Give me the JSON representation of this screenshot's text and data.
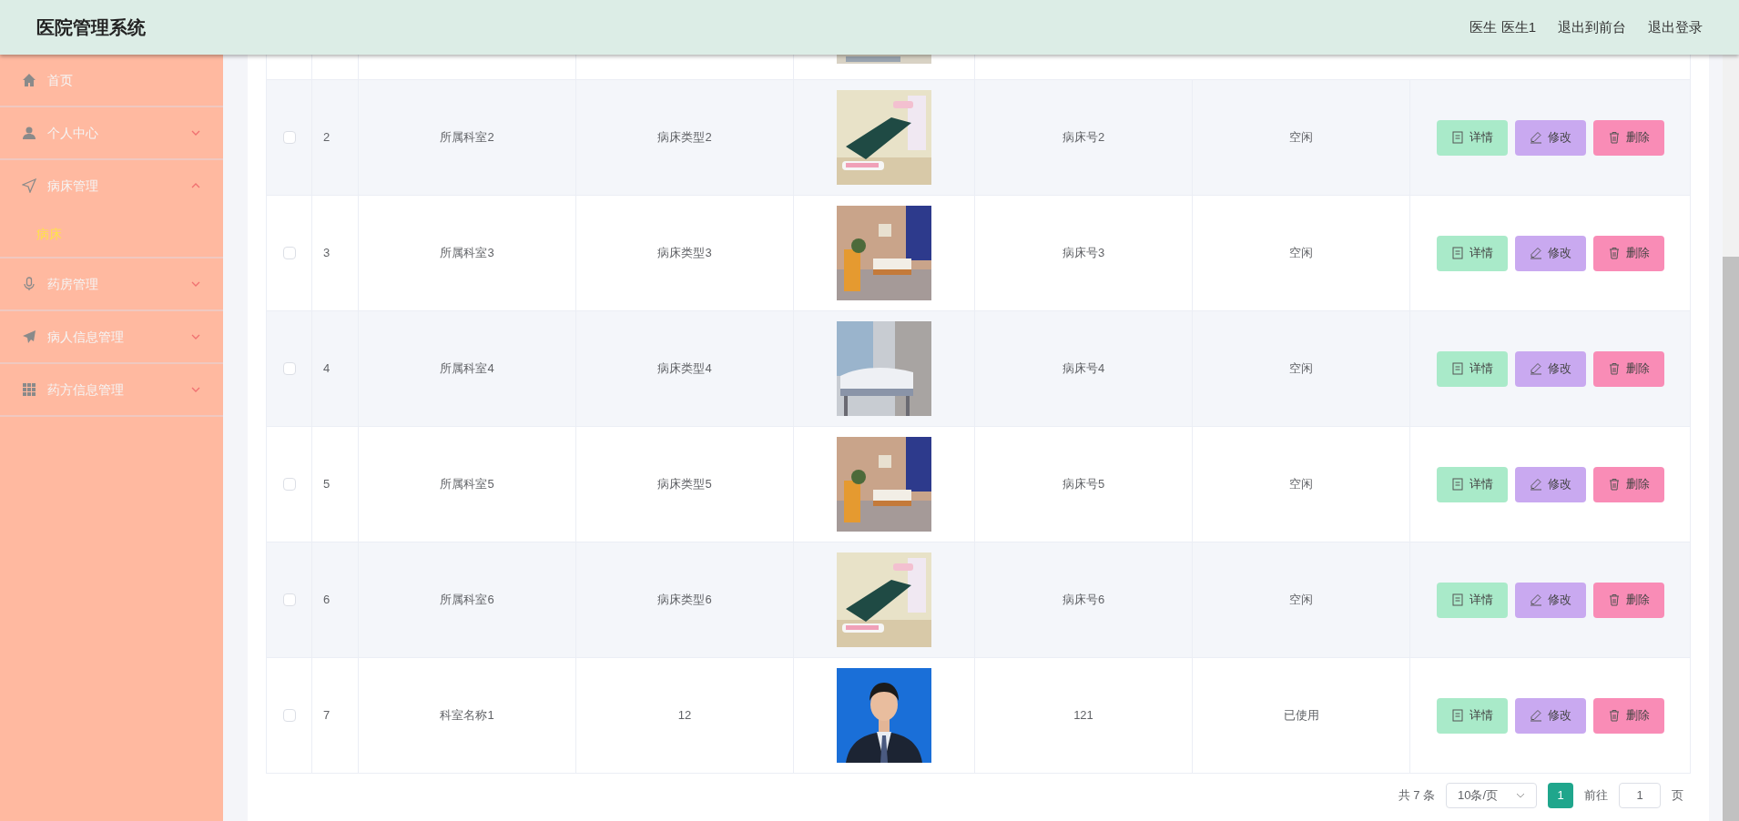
{
  "header": {
    "title": "医院管理系统",
    "user": "医生 医生1",
    "links": [
      "退出到前台",
      "退出登录"
    ]
  },
  "sidebar": {
    "items": [
      {
        "label": "首页",
        "kind": "link"
      },
      {
        "label": "个人中心",
        "kind": "group",
        "expanded": false
      },
      {
        "label": "病床管理",
        "kind": "group",
        "expanded": true,
        "children": [
          {
            "label": "病床",
            "selected": true
          }
        ]
      },
      {
        "label": "药房管理",
        "kind": "group",
        "expanded": false
      },
      {
        "label": "病人信息管理",
        "kind": "group",
        "expanded": false
      },
      {
        "label": "药方信息管理",
        "kind": "group",
        "expanded": false
      }
    ]
  },
  "table": {
    "rows": [
      {
        "checked": false,
        "index": "2",
        "department": "所属科室2",
        "bed_type": "病床类型2",
        "bed_number": "病床号2",
        "status": "空闲",
        "actions": [
          {
            "kind": "detail",
            "label": "详情"
          },
          {
            "kind": "edit",
            "label": "修改"
          },
          {
            "kind": "delete",
            "label": "删除"
          }
        ]
      },
      {
        "checked": false,
        "index": "3",
        "department": "所属科室3",
        "bed_type": "病床类型3",
        "bed_number": "病床号3",
        "status": "空闲",
        "actions": [
          {
            "kind": "detail",
            "label": "详情"
          },
          {
            "kind": "edit",
            "label": "修改"
          },
          {
            "kind": "delete",
            "label": "删除"
          }
        ]
      },
      {
        "checked": false,
        "index": "4",
        "department": "所属科室4",
        "bed_type": "病床类型4",
        "bed_number": "病床号4",
        "status": "空闲",
        "actions": [
          {
            "kind": "detail",
            "label": "详情"
          },
          {
            "kind": "edit",
            "label": "修改"
          },
          {
            "kind": "delete",
            "label": "删除"
          }
        ]
      },
      {
        "checked": false,
        "index": "5",
        "department": "所属科室5",
        "bed_type": "病床类型5",
        "bed_number": "病床号5",
        "status": "空闲",
        "actions": [
          {
            "kind": "detail",
            "label": "详情"
          },
          {
            "kind": "edit",
            "label": "修改"
          },
          {
            "kind": "delete",
            "label": "删除"
          }
        ]
      },
      {
        "checked": false,
        "index": "6",
        "department": "所属科室6",
        "bed_type": "病床类型6",
        "bed_number": "病床号6",
        "status": "空闲",
        "actions": [
          {
            "kind": "detail",
            "label": "详情"
          },
          {
            "kind": "edit",
            "label": "修改"
          },
          {
            "kind": "delete",
            "label": "删除"
          }
        ]
      },
      {
        "checked": false,
        "index": "7",
        "department": "科室名称1",
        "bed_type": "12",
        "bed_number": "121",
        "status": "已使用",
        "actions": [
          {
            "kind": "detail",
            "label": "详情"
          },
          {
            "kind": "edit",
            "label": "修改"
          },
          {
            "kind": "delete",
            "label": "删除"
          }
        ]
      }
    ]
  },
  "pagination": {
    "total": "共 7 条",
    "page_size": "10条/页",
    "pages": [
      {
        "label": "1",
        "selected": true
      }
    ],
    "goto_label": "前往",
    "goto_value": "1",
    "goto_suffix": "页"
  }
}
